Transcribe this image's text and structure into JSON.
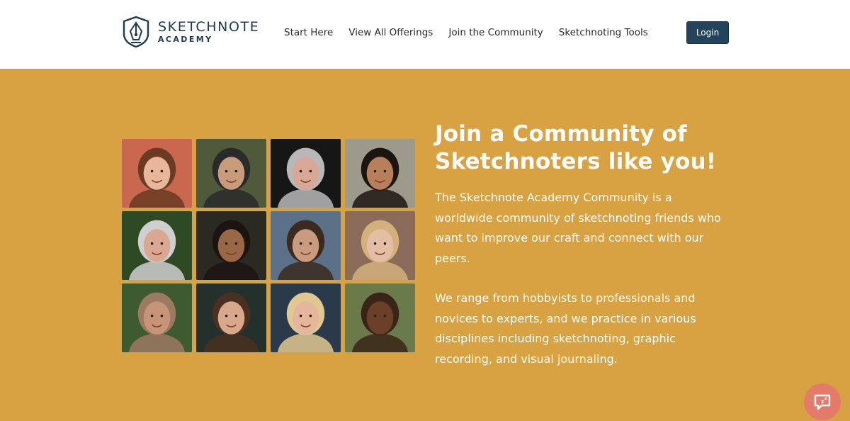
{
  "brand": {
    "line1": "SKETCHNOTE",
    "line2": "ACADEMY",
    "logo_icon": "pen-nib-shield-logo",
    "color": "#1f3a54"
  },
  "nav": {
    "items": [
      {
        "label": "Start Here"
      },
      {
        "label": "View All Offerings"
      },
      {
        "label": "Join the Community"
      },
      {
        "label": "Sketchnoting Tools"
      }
    ],
    "login_label": "Login",
    "login_color": "#23425c"
  },
  "hero": {
    "background": "#d8a141",
    "title": "Join a Community of Sketchnoters like you!",
    "paragraph1": "The Sketchnote Academy Community is a worldwide community of sketchnoting friends who want to improve our craft and connect with our peers.",
    "paragraph2": "We range from hobbyists to professionals and novices to experts, and we practice in various disciplines including sketchnoting, graphic recording, and visual journaling.",
    "photos": [
      {
        "icon": "woman-hat-portrait-photo",
        "bg": "#c9684e",
        "skin": "#e8b79a",
        "hair": "#6b3a22"
      },
      {
        "icon": "man-hoodie-glasses-portrait-photo",
        "bg": "#4f5a3a",
        "skin": "#c89c7a",
        "hair": "#2a2a2a"
      },
      {
        "icon": "woman-short-hair-glasses-portrait-photo",
        "bg": "#161616",
        "skin": "#d7a895",
        "hair": "#b8b8b8"
      },
      {
        "icon": "woman-long-dark-hair-portrait-photo",
        "bg": "#9c9a8a",
        "skin": "#b8805a",
        "hair": "#1c1410"
      },
      {
        "icon": "older-woman-glasses-portrait-photo",
        "bg": "#2e4a24",
        "skin": "#d9a792",
        "hair": "#cfcfcf"
      },
      {
        "icon": "girl-orange-shirt-portrait-photo",
        "bg": "#2a2a22",
        "skin": "#9a6844",
        "hair": "#1c1410"
      },
      {
        "icon": "man-curly-hair-glasses-portrait-photo",
        "bg": "#5c7088",
        "skin": "#c99c80",
        "hair": "#3a2a20"
      },
      {
        "icon": "woman-sunglasses-waving-portrait-photo",
        "bg": "#8a6a58",
        "skin": "#e4bea4",
        "hair": "#d4b07a"
      },
      {
        "icon": "woman-hijab-portrait-photo",
        "bg": "#3e5a30",
        "skin": "#c69478",
        "hair": "#9c7a62"
      },
      {
        "icon": "man-beard-portrait-photo",
        "bg": "#24302c",
        "skin": "#d8a88c",
        "hair": "#4a3020"
      },
      {
        "icon": "older-woman-blonde-portrait-photo",
        "bg": "#2a3a4a",
        "skin": "#e4b69c",
        "hair": "#e0c890"
      },
      {
        "icon": "woman-braids-glasses-portrait-photo",
        "bg": "#6a7a4a",
        "skin": "#6a4028",
        "hair": "#3a2418"
      }
    ]
  },
  "chat": {
    "icon": "chat-bubble-icon",
    "color": "#e47b6a"
  }
}
